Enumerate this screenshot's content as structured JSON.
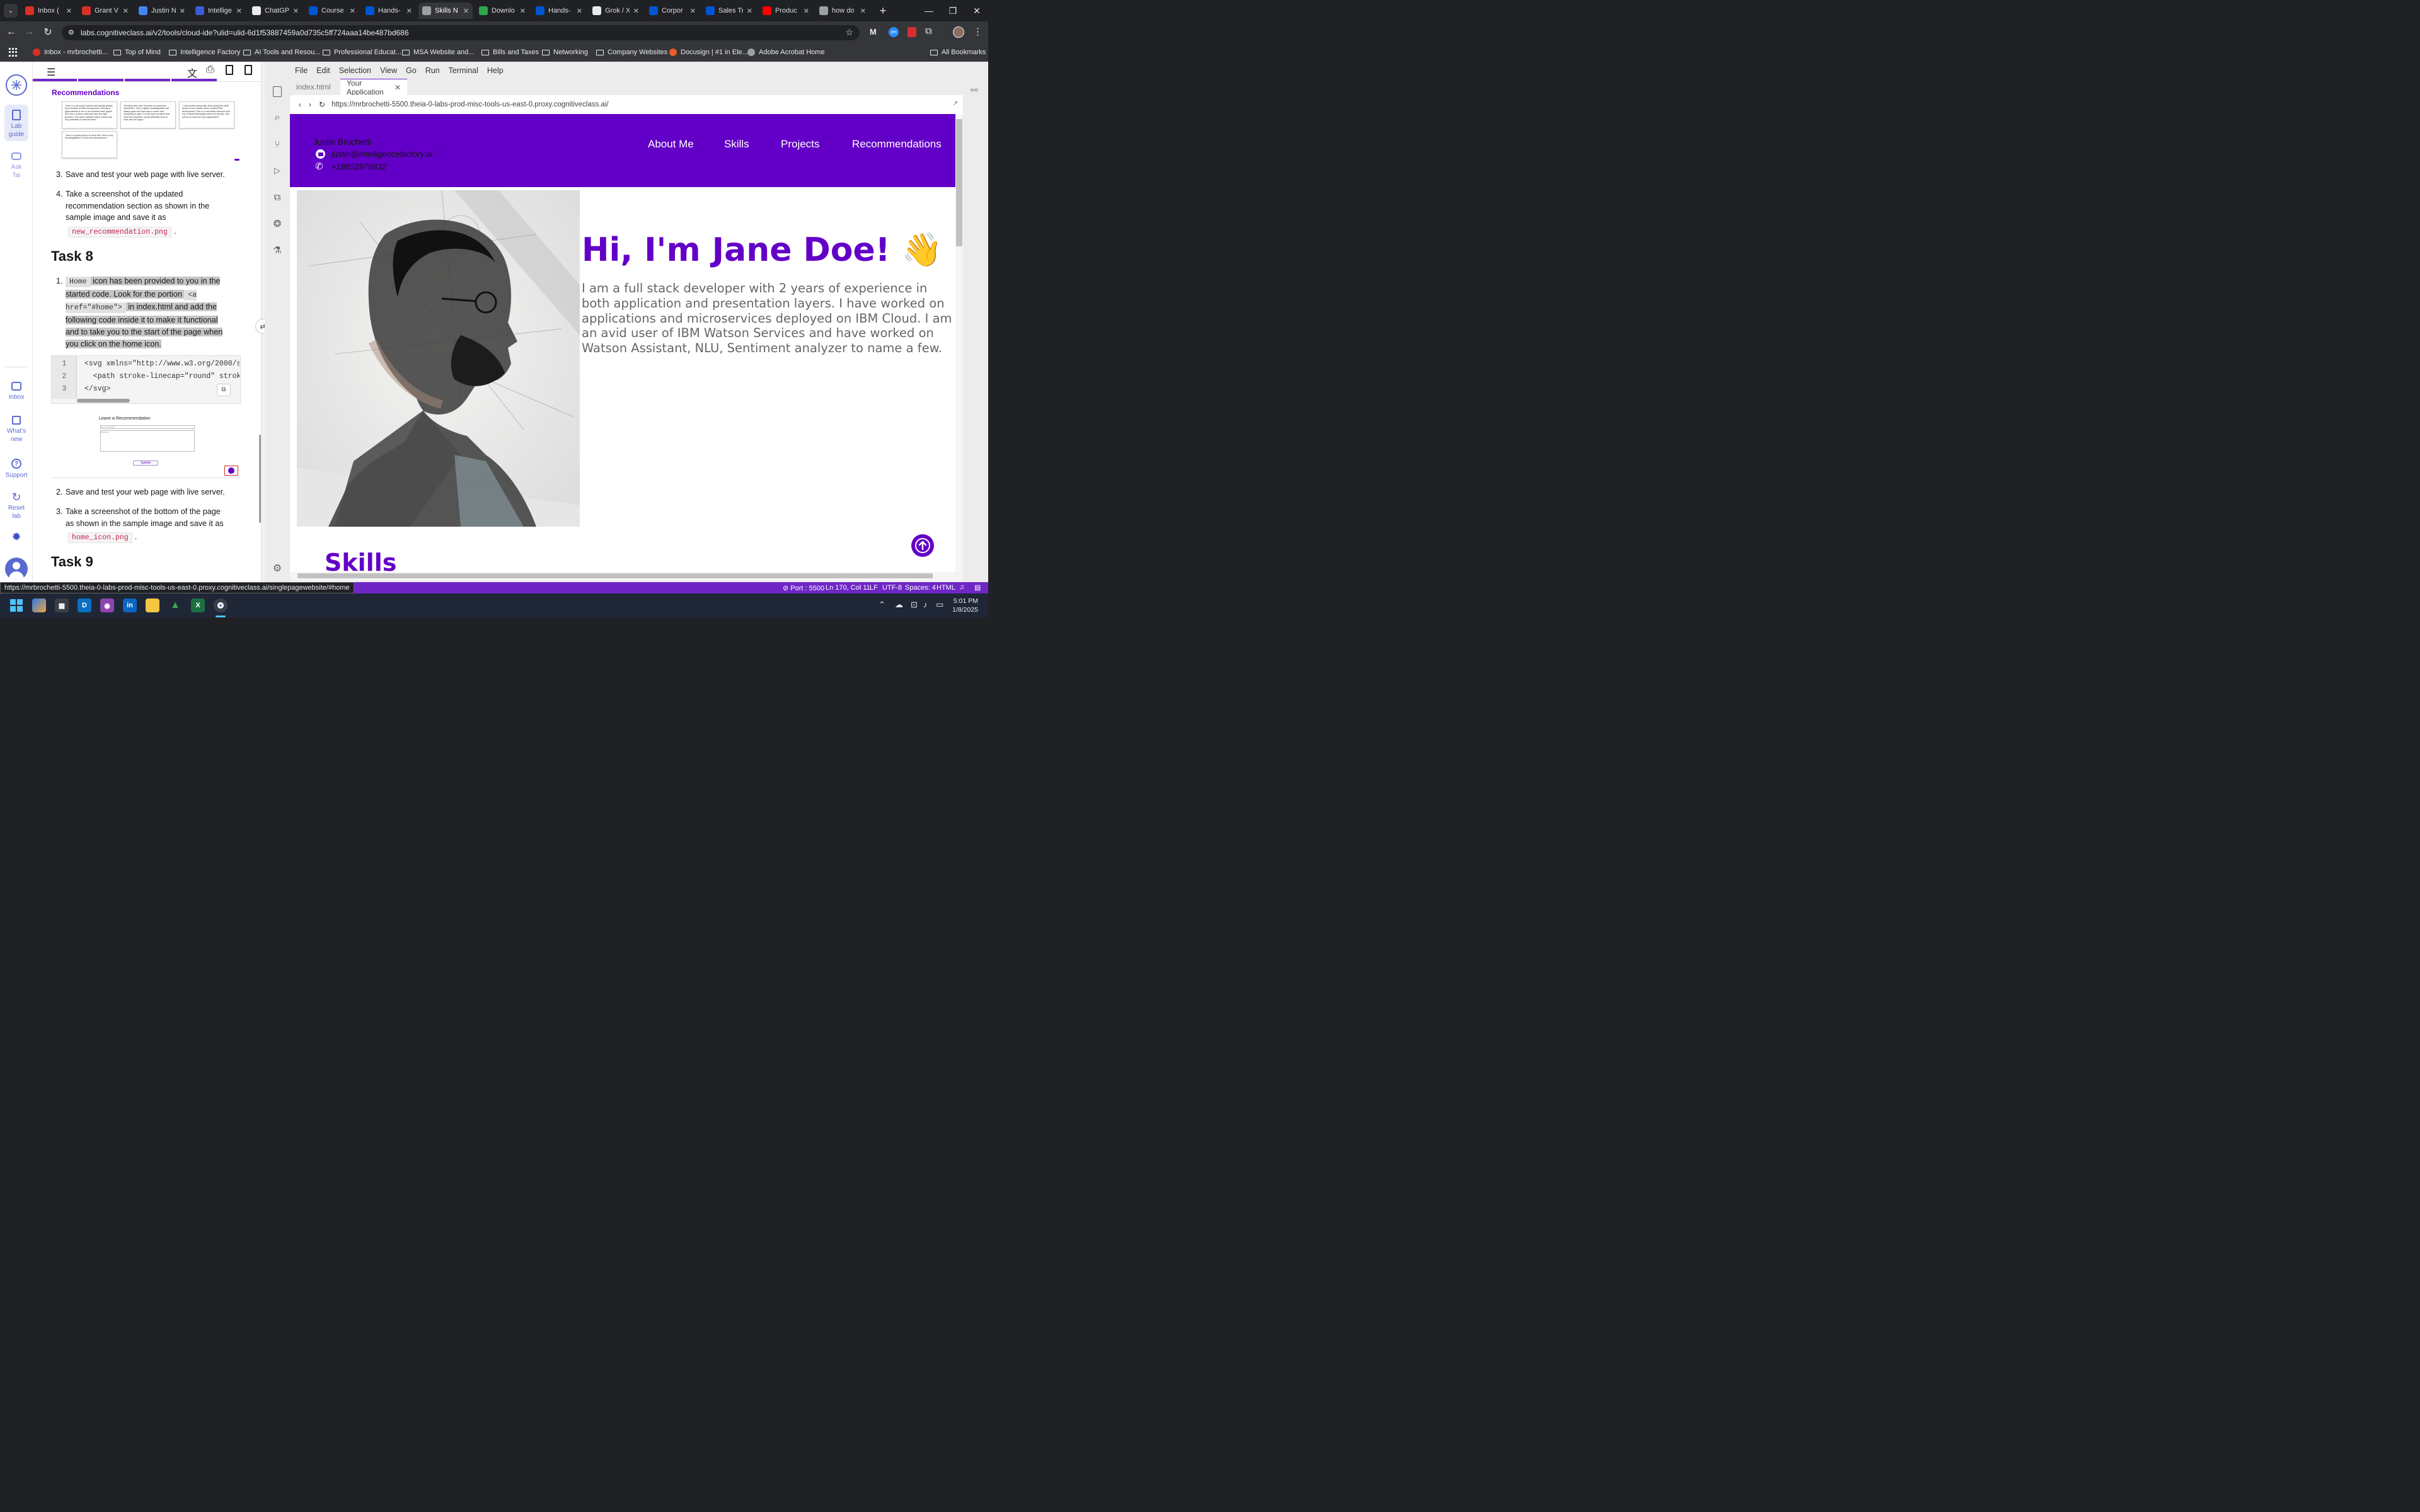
{
  "browser": {
    "tabs": [
      {
        "label": "Inbox (",
        "favicon": "gmail-icon",
        "color": "#d93025"
      },
      {
        "label": "Grant V",
        "favicon": "gmail-icon",
        "color": "#d93025"
      },
      {
        "label": "Justin N",
        "favicon": "docs-icon",
        "color": "#4285f4"
      },
      {
        "label": "Intellige",
        "favicon": "b-icon",
        "color": "#3b5bdb"
      },
      {
        "label": "ChatGP",
        "favicon": "openai-icon",
        "color": "#e8eaed"
      },
      {
        "label": "Course",
        "favicon": "coursera-icon",
        "color": "#0056d2"
      },
      {
        "label": "Hands-",
        "favicon": "coursera-icon",
        "color": "#0056d2"
      },
      {
        "label": "Skills N",
        "favicon": "skills-icon",
        "color": "#9aa0a6"
      },
      {
        "label": "Downlo",
        "favicon": "px-icon",
        "color": "#2ea44f"
      },
      {
        "label": "Hands-",
        "favicon": "coursera-icon",
        "color": "#0056d2"
      },
      {
        "label": "Grok / X",
        "favicon": "x-icon",
        "color": "#e8eaed"
      },
      {
        "label": "Corpor",
        "favicon": "coursera-icon",
        "color": "#0056d2"
      },
      {
        "label": "Sales Tr",
        "favicon": "coursera-icon",
        "color": "#0056d2"
      },
      {
        "label": "Produc",
        "favicon": "youtube-icon",
        "color": "#ff0000"
      },
      {
        "label": "how do",
        "favicon": "globe-icon",
        "color": "#9aa0a6"
      }
    ],
    "active_tab_index": 7,
    "url": "labs.cognitiveclass.ai/v2/tools/cloud-ide?ulid=ulid-6d1f53887459a0d735c5ff724aaa14be487bd686",
    "bookmarks": [
      {
        "label": "Inbox - mrbrochetti...",
        "icon": "gmail-icon"
      },
      {
        "label": "Top of Mind",
        "icon": "folder-icon"
      },
      {
        "label": "Intelligence Factory",
        "icon": "folder-icon"
      },
      {
        "label": "AI Tools and Resou...",
        "icon": "folder-icon"
      },
      {
        "label": "Professional Educat...",
        "icon": "folder-icon"
      },
      {
        "label": "MSA Website and...",
        "icon": "folder-icon"
      },
      {
        "label": "Bills and Taxes",
        "icon": "folder-icon"
      },
      {
        "label": "Networking",
        "icon": "folder-icon"
      },
      {
        "label": "Company Websites",
        "icon": "folder-icon"
      },
      {
        "label": "Docusign | #1 in Ele...",
        "icon": "docusign-icon"
      },
      {
        "label": "Adobe Acrobat Home",
        "icon": "globe-icon"
      }
    ],
    "all_bookmarks": "All Bookmarks",
    "hover_url": "https://mrbrochetti-5500.theia-0-labs-prod-misc-tools-us-east-0.proxy.cognitiveclass.ai/singlepagewebsite/#home"
  },
  "lab": {
    "rail": {
      "lab_guide": "Lab guide",
      "ask_tai": "Ask Tai",
      "inbox": "Inbox",
      "whats_new": "What's new",
      "support": "Support",
      "reset_lab": "Reset lab"
    },
    "recommendations_heading": "Recommendations",
    "rec_cards": [
      "\"Jane is a very quick learner and quickly grasps key concepts of Web development. She got a great attitude & she is an excellent team player. She has a curious mind and asks the right question. She takes initiative within a team and has potentials to lead the team.\"",
      "\"Working with Jane has been an awesome experience. She is highly knowledgeable and always goes the extra step to make sure everything is right. For any future projects that need her expertise I would definitely want to work with her again.\"",
      "\"I had worked along with Jane during the initial phase of our venture which needed Web development. She is a committed resource who has in depth knowledge about the domain. She will be an asset for any organization!\"",
      "\"Jane is a great person to work with. She is very knowledgeable in Front-end development.\""
    ],
    "task7_steps": [
      {
        "num": "3.",
        "text": "Save and test your web page with live server."
      },
      {
        "num": "4.",
        "text": "Take a screenshot of the updated recommendation section as shown in the sample image and save it as",
        "code": "new_recommendation.png",
        "tail": "."
      }
    ],
    "task8_heading": "Task 8",
    "task8_step1": {
      "num": "1.",
      "code1": "Home",
      "t1": "icon has been provided to you in the started code. Look for the portion",
      "code2": "<a href=\"#home\">",
      "t2": "in index.html and add the following code inside it to make it functional and to take you to the start of the page when you click on the home icon."
    },
    "code_lines": [
      {
        "n": "1",
        "text": "<svg xmlns=\"http://www.w3.org/2000/svg\""
      },
      {
        "n": "2",
        "text": "  <path stroke-linecap=\"round\" stroke-li"
      },
      {
        "n": "3",
        "text": "</svg>"
      }
    ],
    "sample_form": {
      "title": "Leave a Recommendation",
      "name_ph": "Name (Optional)",
      "msg_ph": "Message",
      "submit": "Submit"
    },
    "task8_more": [
      {
        "num": "2.",
        "text": "Save and test your web page with live server."
      },
      {
        "num": "3.",
        "text": "Take a screenshot of the bottom of the page as shown in the sample image and save it as",
        "code": "home_icon.png",
        "tail": "."
      }
    ],
    "task9_heading": "Task 9"
  },
  "ide": {
    "menu": [
      "File",
      "Edit",
      "Selection",
      "View",
      "Go",
      "Run",
      "Terminal",
      "Help"
    ],
    "tabs": [
      {
        "label": "index.html"
      },
      {
        "label": "Your Application"
      }
    ],
    "preview_url": "https://mrbrochetti-5500.theia-0-labs-prod-misc-tools-us-east-0.proxy.cognitiveclass.ai/",
    "status": {
      "port": "Port : 5500",
      "position": "Ln 170, Col 11",
      "eol": "LF",
      "encoding": "UTF-8",
      "spaces": "Spaces: 4",
      "lang": "HTML"
    }
  },
  "site": {
    "name": "Justin Brochetti",
    "email": "justin@intelligencefactory.ai",
    "phone": "+18652976832",
    "nav": [
      "About Me",
      "Skills",
      "Projects",
      "Recommendations"
    ],
    "hero_title": "Hi, I'm Jane Doe! 👋",
    "hero_desc": "I am a full stack developer with 2 years of experience in both application and presentation layers. I have worked on applications and microservices deployed on IBM Cloud. I am an avid user of IBM Watson Services and have worked on Watson Assistant, NLU, Sentiment analyzer to name a few.",
    "skills_heading": "Skills",
    "brand_color": "#6300c7"
  },
  "system": {
    "time": "5:01 PM",
    "date": "1/8/2025"
  }
}
